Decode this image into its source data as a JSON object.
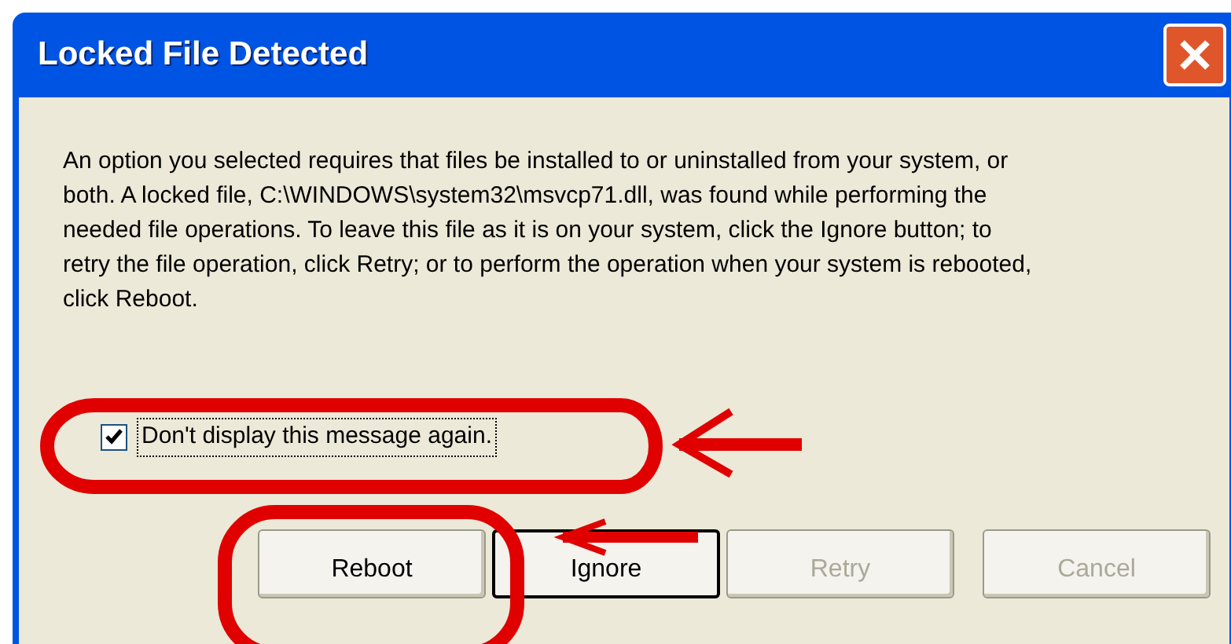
{
  "window": {
    "title": "Locked File Detected"
  },
  "message": "An option you selected requires that files be installed to or uninstalled from your system, or both. A locked file, C:\\WINDOWS\\system32\\msvcp71.dll, was found while performing the needed file operations. To leave this file as it is on your system, click the Ignore button; to retry the file operation, click Retry; or to perform the operation when your system is rebooted, click Reboot.",
  "checkbox": {
    "label": "Don't display this message again.",
    "checked": true
  },
  "buttons": [
    {
      "label": "Reboot",
      "disabled": false,
      "default": false
    },
    {
      "label": "Ignore",
      "disabled": false,
      "default": true
    },
    {
      "label": "Retry",
      "disabled": true,
      "default": false
    },
    {
      "label": "Cancel",
      "disabled": true,
      "default": false
    }
  ]
}
